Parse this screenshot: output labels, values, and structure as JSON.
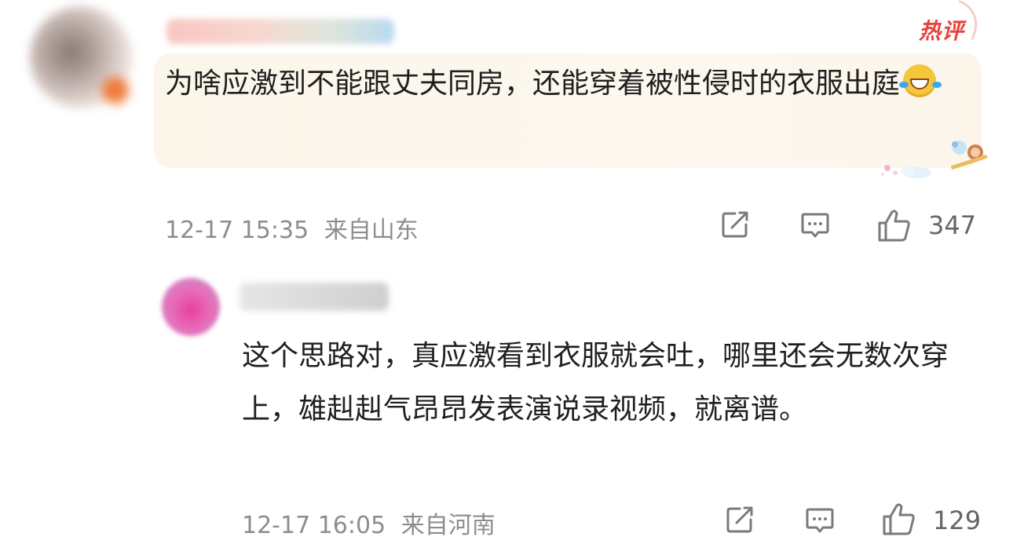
{
  "top_comment": {
    "hot_badge": "热评",
    "text": "为啥应激到不能跟丈夫同房，还能穿着被性侵时的衣服出庭",
    "emoji": "laughing-crying-emoji",
    "timestamp": "12-17 15:35",
    "location": "来自山东",
    "likes": "347",
    "icons": [
      "share-icon",
      "comment-icon",
      "like-icon"
    ],
    "accent_color": "#e8423c",
    "bubble_color": "#fbf6ea"
  },
  "reply": {
    "text": "这个思路对，真应激看到衣服就会吐，哪里还会无数次穿上，雄赳赳气昂昂发表演说录视频，就离谱。",
    "timestamp": "12-17 16:05",
    "location": "来自河南",
    "likes": "129",
    "icons": [
      "share-icon",
      "comment-icon",
      "like-icon"
    ]
  }
}
